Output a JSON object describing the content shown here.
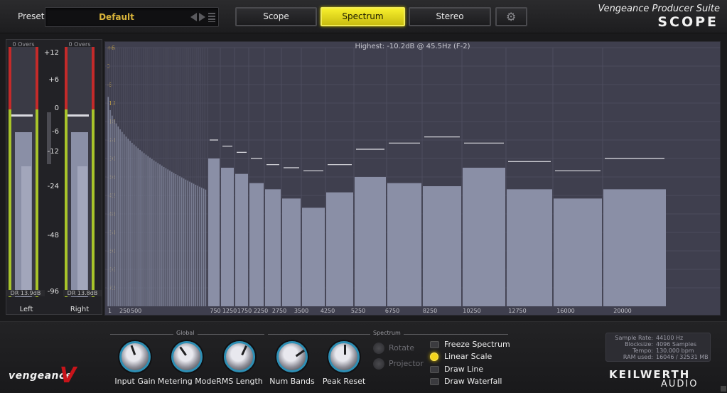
{
  "header": {
    "preset_label": "Preset",
    "preset_name": "Default",
    "tabs": [
      "Scope",
      "Spectrum",
      "Stereo"
    ],
    "active_tab": "Spectrum",
    "brand_title": "Vengeance Producer Suite",
    "brand_product": "SCOPE"
  },
  "meters": {
    "left": {
      "overs": "0 Overs",
      "dr": "DR 13.9dB",
      "label": "Left"
    },
    "right": {
      "overs": "0 Overs",
      "dr": "DR 13.8dB",
      "label": "Right"
    },
    "db_scale": [
      "+12",
      "+6",
      "0",
      "-6",
      "-12",
      "-24",
      "-48",
      "-96"
    ]
  },
  "spectrum": {
    "highest_text": "Highest: -10.2dB @ 45.5Hz (F-2)",
    "db_labels": [
      "+6",
      "0",
      "-6",
      "-12",
      "-18",
      "-24",
      "-30",
      "-36",
      "-42",
      "-48",
      "-54",
      "-60",
      "-66",
      "-72"
    ],
    "freq_labels": [
      "750",
      "1250",
      "1750",
      "2250",
      "2750",
      "3500",
      "4250",
      "5250",
      "6750",
      "8250",
      "10250",
      "12750",
      "16000",
      "20000"
    ],
    "freq_labels_left": [
      "1",
      "250",
      "500"
    ]
  },
  "chart_data": {
    "type": "bar",
    "title": "",
    "xlabel": "",
    "ylabel": "",
    "x_scale": "linear",
    "xlim": [
      0,
      22050
    ],
    "ylim": [
      -78,
      6
    ],
    "bands": [
      {
        "center": 500,
        "level": -30,
        "peak": -24
      },
      {
        "center": 750,
        "level": -33,
        "peak": -26
      },
      {
        "center": 1250,
        "level": -35,
        "peak": -28
      },
      {
        "center": 1750,
        "level": -38,
        "peak": -30
      },
      {
        "center": 2250,
        "level": -40,
        "peak": -32
      },
      {
        "center": 2750,
        "level": -43,
        "peak": -33
      },
      {
        "center": 3500,
        "level": -46,
        "peak": -34
      },
      {
        "center": 4250,
        "level": -41,
        "peak": -32
      },
      {
        "center": 5250,
        "level": -36,
        "peak": -27
      },
      {
        "center": 6750,
        "level": -38,
        "peak": -25
      },
      {
        "center": 8250,
        "level": -39,
        "peak": -23
      },
      {
        "center": 10250,
        "level": -33,
        "peak": -25
      },
      {
        "center": 12750,
        "level": -40,
        "peak": -31
      },
      {
        "center": 16000,
        "level": -43,
        "peak": -34
      },
      {
        "center": 20000,
        "level": -40,
        "peak": -30
      }
    ]
  },
  "controls": {
    "global_label": "Global",
    "spectrum_label": "Spectrum",
    "knobs": [
      {
        "label": "Input Gain",
        "angle": -20
      },
      {
        "label": "Metering Mode",
        "angle": -35
      },
      {
        "label": "RMS Length",
        "angle": 25
      },
      {
        "label": "Num Bands",
        "angle": 55
      },
      {
        "label": "Peak Reset",
        "angle": 0
      }
    ],
    "rotate_label": "Rotate",
    "projector_label": "Projector",
    "options": [
      {
        "label": "Freeze Spectrum",
        "on": false
      },
      {
        "label": "Linear Scale",
        "on": true
      },
      {
        "label": "Draw Line",
        "on": false
      },
      {
        "label": "Draw Waterfall",
        "on": false
      }
    ]
  },
  "info": {
    "sample_rate_key": "Sample Rate:",
    "sample_rate": "44100 Hz",
    "blocksize_key": "Blocksize:",
    "blocksize": "4096 Samples",
    "tempo_key": "Tempo:",
    "tempo": "130.000 bpm",
    "ram_key": "RAM used:",
    "ram": "16046 / 32531 MB"
  },
  "footer": {
    "logo": "vengeance",
    "keilwerth": "KEILWERTH",
    "audio": "AUDIO"
  },
  "colors": {
    "accent_yellow": "#f7ef2c",
    "bar": "#8a8fa6",
    "meter_red": "#c42a2a",
    "meter_green": "#a8c42a",
    "knob_ring": "#2d8fb5"
  }
}
